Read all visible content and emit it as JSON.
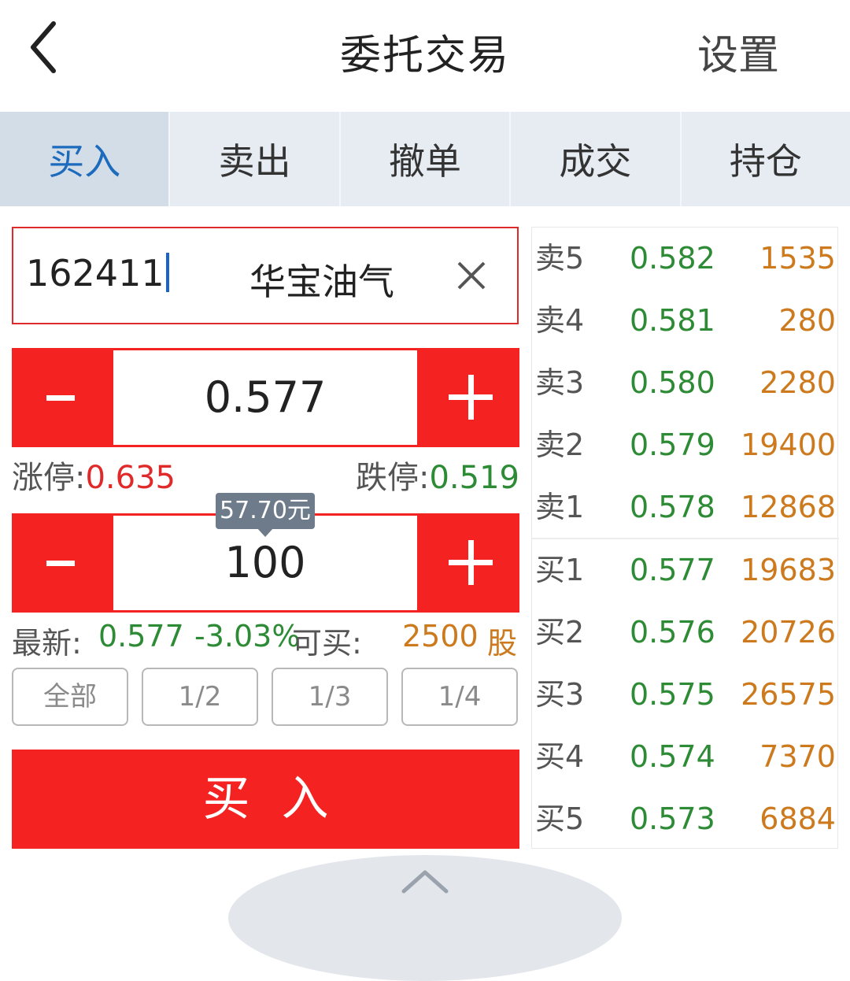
{
  "header": {
    "title": "委托交易",
    "settings_label": "设置"
  },
  "tabs": [
    {
      "label": "买入",
      "active": true
    },
    {
      "label": "卖出",
      "active": false
    },
    {
      "label": "撤单",
      "active": false
    },
    {
      "label": "成交",
      "active": false
    },
    {
      "label": "持仓",
      "active": false
    }
  ],
  "order": {
    "code": "162411",
    "name": "华宝油气",
    "price": "0.577",
    "limit_up_label": "涨停:",
    "limit_up": "0.635",
    "limit_down_label": "跌停:",
    "limit_down": "0.519",
    "amount_tip": "57.70元",
    "quantity": "100",
    "latest_label": "最新:",
    "latest": "0.577",
    "change": "-3.03%",
    "can_buy_label": "可买:",
    "can_buy": "2500",
    "can_buy_unit": "股",
    "quick": [
      "全部",
      "1/2",
      "1/3",
      "1/4"
    ],
    "submit_label": "买入"
  },
  "book": [
    {
      "level": "卖5",
      "price": "0.582",
      "volume": "1535"
    },
    {
      "level": "卖4",
      "price": "0.581",
      "volume": "280"
    },
    {
      "level": "卖3",
      "price": "0.580",
      "volume": "2280"
    },
    {
      "level": "卖2",
      "price": "0.579",
      "volume": "19400"
    },
    {
      "level": "卖1",
      "price": "0.578",
      "volume": "12868"
    },
    {
      "level": "买1",
      "price": "0.577",
      "volume": "19683"
    },
    {
      "level": "买2",
      "price": "0.576",
      "volume": "20726"
    },
    {
      "level": "买3",
      "price": "0.575",
      "volume": "26575"
    },
    {
      "level": "买4",
      "price": "0.574",
      "volume": "7370"
    },
    {
      "level": "买5",
      "price": "0.573",
      "volume": "6884"
    }
  ],
  "colors": {
    "accent_red": "#f52222",
    "up_red": "#e02a2a",
    "down_green": "#2e8b35",
    "volume_orange": "#cc7a1d",
    "tab_active_blue": "#1d6bbd"
  },
  "icons": [
    "back-icon",
    "clear-icon",
    "minus-icon",
    "plus-icon",
    "chevron-up-icon"
  ]
}
